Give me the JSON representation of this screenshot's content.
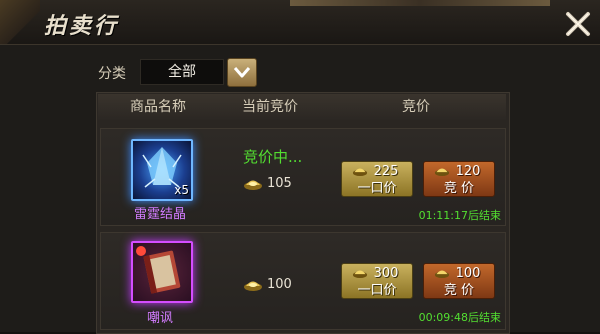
{
  "window": {
    "title": "拍卖行"
  },
  "filter": {
    "label": "分类",
    "selected": "全部"
  },
  "columns": {
    "name": "商品名称",
    "current_bid": "当前竞价",
    "bid": "竞价"
  },
  "items": [
    {
      "name": "雷霆结晶",
      "quantity": "x5",
      "status": "竞价中...",
      "current_price": "105",
      "buyout_price": "225",
      "buyout_label": "一口价",
      "bid_price": "120",
      "bid_label": "竞 价",
      "timer": "01:11:17后结束"
    },
    {
      "name": "嘲讽",
      "quantity": "",
      "status": "",
      "current_price": "100",
      "buyout_price": "300",
      "buyout_label": "一口价",
      "bid_price": "100",
      "bid_label": "竞 价",
      "timer": "00:09:48后结束"
    }
  ],
  "icons": {
    "close": "close-x-icon",
    "dropdown": "chevron-down-icon",
    "currency": "gold-ingot-icon",
    "item1": "thunder-crystal-icon",
    "item2": "taunt-book-icon"
  },
  "colors": {
    "status_green": "#53df31",
    "item_purple": "#d27cff",
    "gold_button": "#c9b15e",
    "copper_button": "#c2682b"
  }
}
